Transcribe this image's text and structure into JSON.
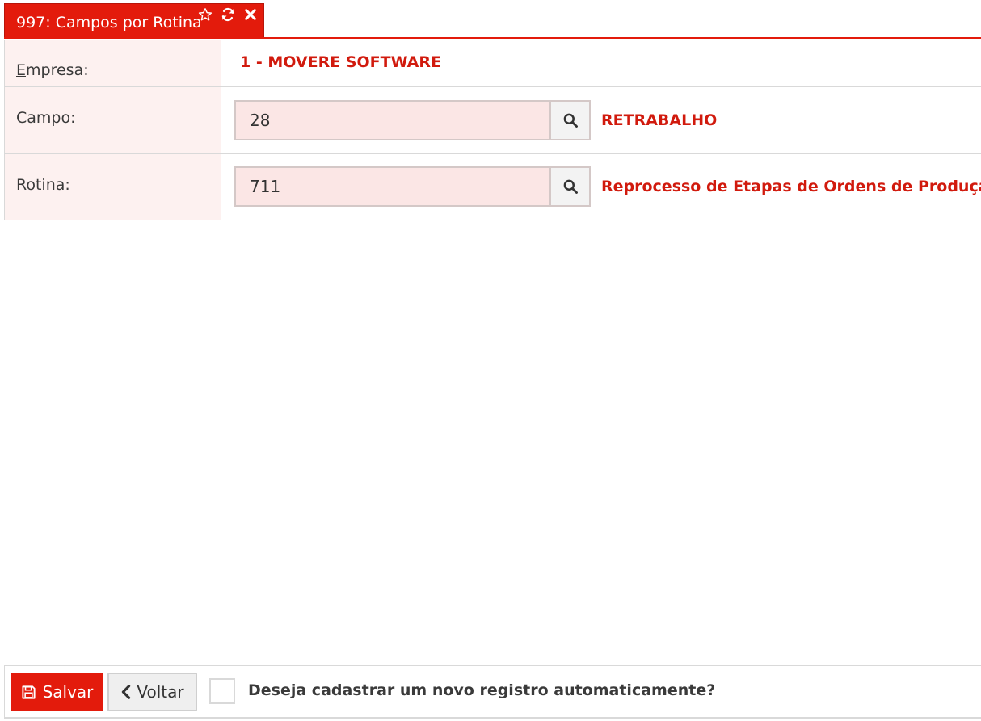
{
  "tab": {
    "title": "997: Campos por Rotina",
    "icons": [
      "star-icon",
      "refresh-icon",
      "close-icon"
    ]
  },
  "form": {
    "empresa": {
      "label_first": "E",
      "label_rest": "mpresa:",
      "value": "1 - MOVERE SOFTWARE"
    },
    "campo": {
      "label": "Campo:",
      "value": "28",
      "description": "RETRABALHO"
    },
    "rotina": {
      "label_first": "R",
      "label_rest": "otina:",
      "value": "711",
      "description": "Reprocesso de Etapas de Ordens de Produção"
    }
  },
  "footer": {
    "save_label": "Salvar",
    "back_label": "Voltar",
    "checkbox_label": "Deseja cadastrar um novo registro automaticamente?",
    "checkbox_checked": false
  },
  "colors": {
    "accent": "#e31b0c",
    "value_text": "#d11a0d",
    "label_bg": "#fdf1f0",
    "input_bg": "#fbe6e5"
  }
}
